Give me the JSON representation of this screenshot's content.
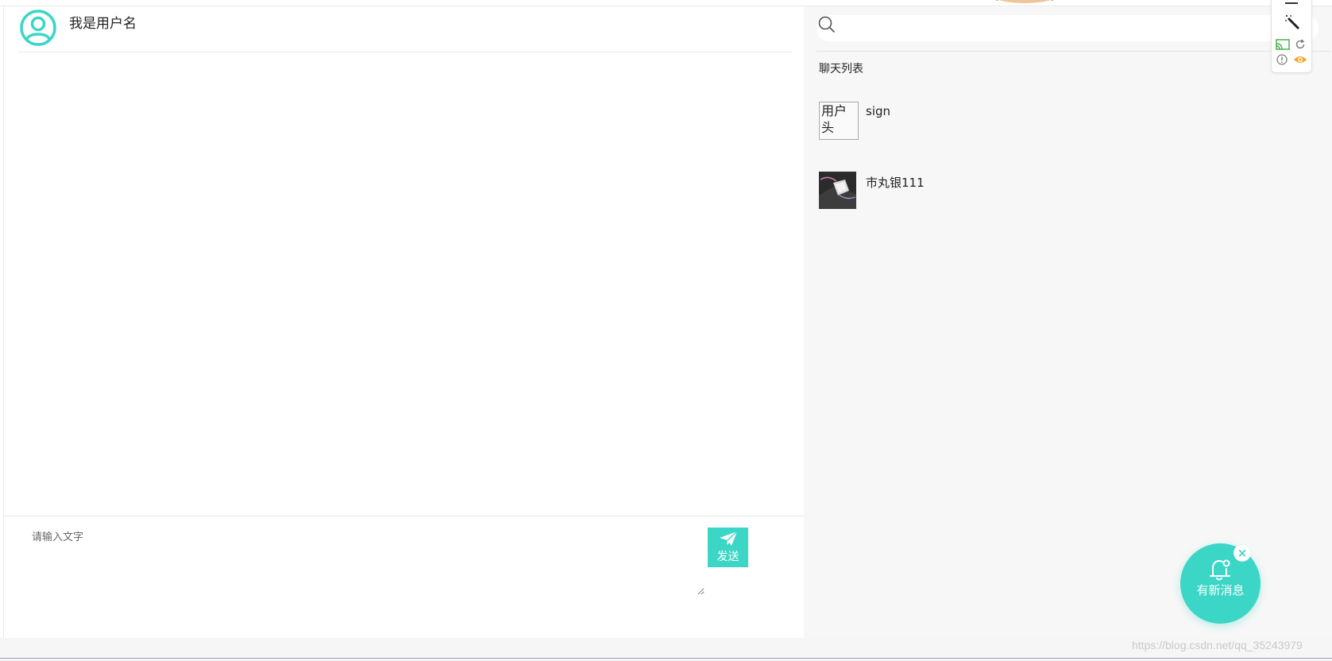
{
  "chat": {
    "user_name": "我是用户名",
    "input_placeholder": "请输入文字",
    "send_label": "发送"
  },
  "sidebar": {
    "list_title": "聊天列表",
    "contacts": [
      {
        "name": "sign",
        "avatar_alt": "用户头"
      },
      {
        "name": "市丸银111"
      }
    ]
  },
  "notification": {
    "label": "有新消息",
    "close_glyph": "×"
  },
  "watermark": "https://blog.csdn.net/qq_35243979",
  "colors": {
    "accent": "#3cd6c6",
    "panel_bg": "#f7f7f7"
  },
  "icons": [
    "user-avatar-icon",
    "search-icon",
    "paper-plane-icon",
    "bell-icon",
    "close-icon"
  ]
}
